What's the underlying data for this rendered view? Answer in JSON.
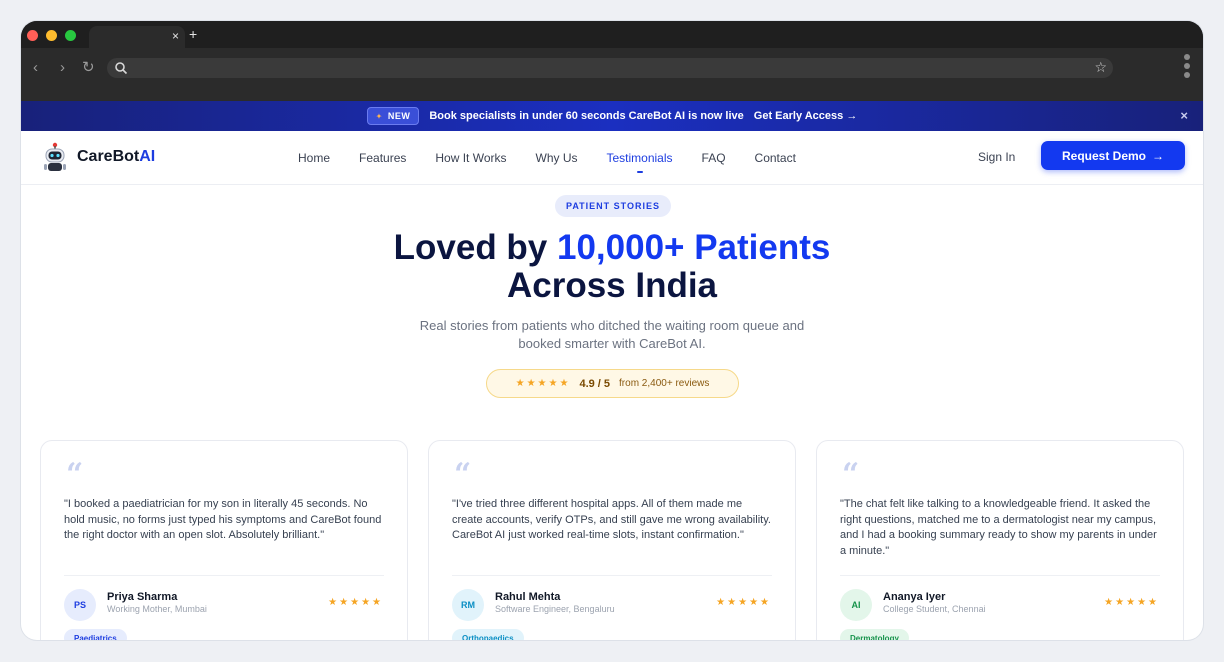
{
  "browser": {
    "tab_close": "×",
    "tab_new": "+",
    "back": "‹",
    "forward": "›",
    "reload": "↻",
    "bookmark": "☆"
  },
  "announcement": {
    "badge": "NEW",
    "text": "Book specialists in under 60 seconds CareBot AI is now live",
    "cta": "Get Early Access →",
    "close": "×"
  },
  "header": {
    "logo_main": "CareBot",
    "logo_accent": "AI",
    "nav": [
      "Home",
      "Features",
      "How It Works",
      "Why Us",
      "Testimonials",
      "FAQ",
      "Contact"
    ],
    "active_nav": "Testimonials",
    "signin": "Sign In",
    "demo": "Request Demo",
    "demo_arrow": "→"
  },
  "hero": {
    "pill": "PATIENT STORIES",
    "title_part1": "Loved by ",
    "title_highlight": "10,000+ Patients",
    "title_line2": "Across India",
    "sub_line1": "Real stories from patients who ditched the waiting room queue and",
    "sub_line2": "booked smarter with CareBot AI.",
    "rating_stars": "★★★★★",
    "rating_score": "4.9 / 5",
    "rating_reviews": "from 2,400+ reviews"
  },
  "testimonials": [
    {
      "quote": "\"I booked a paediatrician for my son in literally 45 seconds. No hold music, no forms just typed his symptoms and CareBot found the right doctor with an open slot. Absolutely brilliant.\"",
      "initials": "PS",
      "name": "Priya Sharma",
      "role": "Working Mother, Mumbai",
      "stars": "★★★★★",
      "tag": "Paediatrics"
    },
    {
      "quote": "\"I've tried three different hospital apps. All of them made me create accounts, verify OTPs, and still gave me wrong availability. CareBot AI just worked real-time slots, instant confirmation.\"",
      "initials": "RM",
      "name": "Rahul Mehta",
      "role": "Software Engineer, Bengaluru",
      "stars": "★★★★★",
      "tag": "Orthopaedics"
    },
    {
      "quote": "\"The chat felt like talking to a knowledgeable friend. It asked the right questions, matched me to a dermatologist near my campus, and I had a booking summary ready to show my parents in under a minute.\"",
      "initials": "AI",
      "name": "Ananya Iyer",
      "role": "College Student, Chennai",
      "stars": "★★★★★",
      "tag": "Dermatology"
    }
  ],
  "colors": {
    "brand": "#1339f0",
    "navy": "#0b1540",
    "star": "#f5a524"
  }
}
